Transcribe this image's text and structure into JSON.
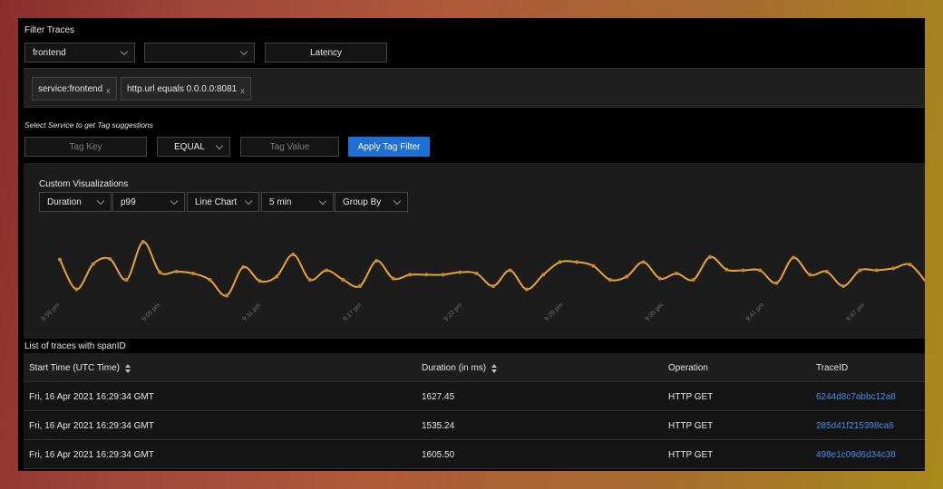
{
  "filter": {
    "title": "Filter Traces",
    "service_value": "frontend",
    "operation_value": "",
    "latency_label": "Latency"
  },
  "tags": [
    {
      "label": "service:frontend",
      "remove": "x"
    },
    {
      "label": "http.url equals 0.0.0.0:8081",
      "remove": "x"
    }
  ],
  "tag_filter": {
    "hint": "Select Service to get Tag suggestions",
    "key_placeholder": "Tag Key",
    "operator_value": "EQUAL",
    "value_placeholder": "Tag Value",
    "apply_label": "Apply Tag Filter"
  },
  "viz": {
    "title": "Custom Visualizations",
    "controls": [
      "Duration",
      "p99",
      "Line Chart",
      "5 min",
      "Group By"
    ]
  },
  "chart_data": {
    "type": "line",
    "x_tick_labels": [
      "8:59 pm",
      "9:05 pm",
      "9:11 pm",
      "9:17 pm",
      "9:23 pm",
      "9:29 pm",
      "9:35 pm",
      "9:41 pm",
      "9:47 pm"
    ],
    "values": [
      0.62,
      0.15,
      0.55,
      0.63,
      0.3,
      0.9,
      0.42,
      0.43,
      0.4,
      0.3,
      0.05,
      0.5,
      0.28,
      0.35,
      0.7,
      0.3,
      0.45,
      0.3,
      0.2,
      0.6,
      0.32,
      0.38,
      0.38,
      0.38,
      0.42,
      0.4,
      0.2,
      0.45,
      0.15,
      0.38,
      0.58,
      0.58,
      0.52,
      0.3,
      0.35,
      0.58,
      0.32,
      0.4,
      0.3,
      0.66,
      0.46,
      0.45,
      0.45,
      0.25,
      0.65,
      0.38,
      0.43,
      0.2,
      0.45,
      0.45,
      0.48,
      0.54,
      0.25
    ],
    "color": "#e8a33c",
    "grid": false,
    "legend": "none"
  },
  "table": {
    "title": "List of traces with spanID",
    "columns": [
      "Start Time (UTC Time)",
      "Duration (in ms)",
      "Operation",
      "TraceID"
    ],
    "rows": [
      [
        "Fri, 16 Apr 2021 16:29:34 GMT",
        "1627.45",
        "HTTP GET",
        "6244d8c7abbc12a8"
      ],
      [
        "Fri, 16 Apr 2021 16:29:34 GMT",
        "1535.24",
        "HTTP GET",
        "285d41f215398ca6"
      ],
      [
        "Fri, 16 Apr 2021 16:29:34 GMT",
        "1605.50",
        "HTTP GET",
        "498e1c09d6d34c38"
      ]
    ]
  },
  "colors": {
    "accent": "#1f6fd8",
    "link": "#3b8ee6",
    "line": "#e8a33c"
  }
}
